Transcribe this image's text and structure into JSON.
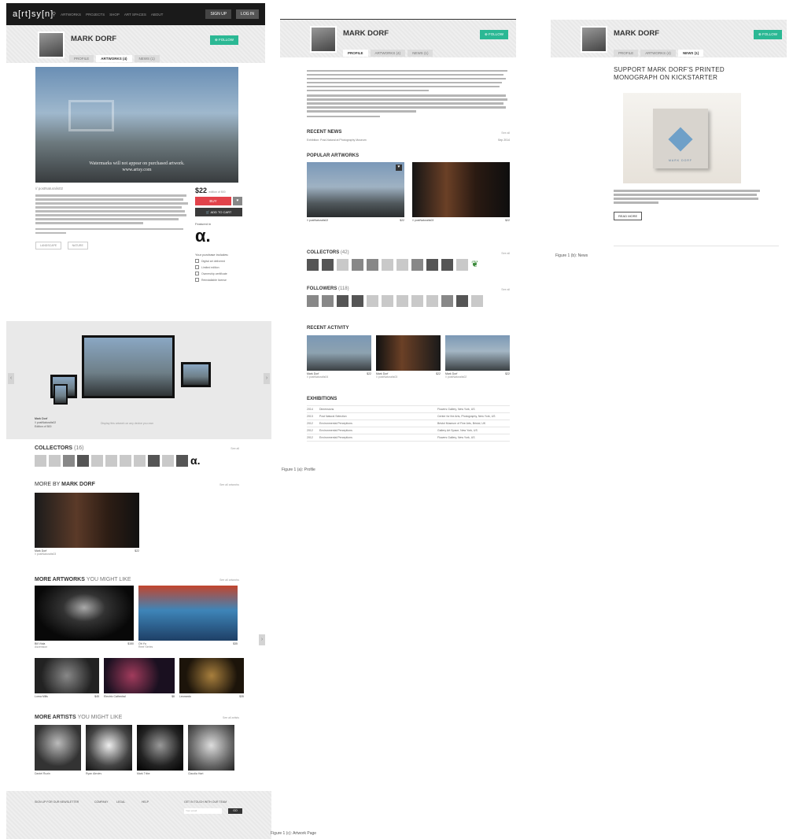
{
  "nav": {
    "logo": "a[rt]sy[n]",
    "links": [
      "ARTWORKS",
      "PROJECTS",
      "SHOP",
      "ART SPACES",
      "ABOUT"
    ],
    "signup": "SIGN UP",
    "login": "LOG IN"
  },
  "artist": {
    "name": "MARK DORF",
    "follow_label": "FOLLOW",
    "tabs": [
      "PROFILE",
      "ARTWORKS (4)",
      "NEWS (1)"
    ]
  },
  "artwork": {
    "watermark_line1": "Watermarks will not appear on purchased artwork.",
    "watermark_line2": "www.artsy.com",
    "caption": "// postNaturalis02",
    "price": "$22",
    "price_note": "edition of 500",
    "buy_label": "BUY",
    "add_to_cart": "ADD TO CART",
    "presented_by": "Featured in",
    "purchase_includes": "Your purchase includes:",
    "features": [
      "Digital art delivered",
      "Limited edition",
      "Ownership certificate",
      "Reinstallable license"
    ],
    "tags": [
      "LANDSCAPE",
      "NATURE"
    ]
  },
  "devices_band": {
    "caption_name": "Mark Dorf",
    "caption_work": "// postNaturalis02",
    "caption_detail": "Edition of 500",
    "note": "Display this artwork on any device you own"
  },
  "collectors": {
    "title": "COLLECTORS",
    "count": "(16)",
    "see_all": "See all"
  },
  "more_by": {
    "title_prefix": "MORE BY",
    "title_name": "MARK DORF",
    "see_all": "See all artworks",
    "art_name": "Mark Dorf",
    "art_title": "// postNaturalis03",
    "art_price": "$22"
  },
  "more_artworks": {
    "title_prefix": "MORE ARTWORKS",
    "title_suffix": "YOU MIGHT LIKE",
    "see_all": "See all artworks",
    "items": [
      {
        "artist": "Bill Viola",
        "title": "Ascension",
        "price": "$150"
      },
      {
        "artist": "Oh Yu",
        "title": "Reef Series",
        "price": "$35"
      },
      {
        "artist": "Lorna Mills",
        "title": "Gif Ghost",
        "price": "$45"
      },
      {
        "artist": "Electric Cathedral",
        "title": "Bliss 02",
        "price": "$8"
      },
      {
        "artist": "Leonardo",
        "title": "Garden",
        "price": "$35"
      }
    ]
  },
  "more_artists": {
    "title_prefix": "MORE ARTISTS",
    "title_suffix": "YOU MIGHT LIKE",
    "see_all": "See all artists",
    "items": [
      "Daniel Rozin",
      "Ryan Alexiev",
      "Mark Tribe",
      "Claudia Hart"
    ]
  },
  "footer": {
    "columns": [
      "SIGN UP FOR OUR NEWSLETTER",
      "COMPANY",
      "LEGAL",
      "HELP",
      "GET IN TOUCH WITH OUR TEAM"
    ],
    "newsletter_placeholder": "Your email",
    "newsletter_button": "GO"
  },
  "profile": {
    "recent_news": "RECENT NEWS",
    "recent_news_item": "Exhibition: Post-Natural at Photography Museum",
    "recent_news_date": "Sep 2014",
    "popular_artworks": "POPULAR ARTWORKS",
    "pop1_title": "// postNaturalis02",
    "pop1_price": "$22",
    "pop2_title": "// postNaturalis03",
    "pop2_price": "$22",
    "collectors": "COLLECTORS",
    "collectors_count": "(42)",
    "followers": "FOLLOWERS",
    "followers_count": "(118)",
    "recent_activity": "RECENT ACTIVITY",
    "activity": [
      {
        "name": "Mark Dorf",
        "title": "// postNaturalis04",
        "price": "$22"
      },
      {
        "name": "Mark Dorf",
        "title": "// postNaturalis03",
        "price": "$22"
      },
      {
        "name": "Mark Dorf",
        "title": "// postNaturalis02",
        "price": "$22"
      }
    ],
    "exhibitions": "EXHIBITIONS",
    "exhibition_rows": [
      {
        "year": "2014",
        "title": "Dimensions",
        "venue": "Flowers Gallery, New York, US"
      },
      {
        "year": "2013",
        "title": "Post Natural Selection",
        "venue": "Center for the Arts, Photography, New York, US"
      },
      {
        "year": "2012",
        "title": "Environmental Perceptions",
        "venue": "Bristol Museum of Fine Arts, Bristol, UK"
      },
      {
        "year": "2012",
        "title": "Environmental Perceptions",
        "venue": "Gallery Art Space, New York, US"
      },
      {
        "year": "2012",
        "title": "Environmental Perceptions",
        "venue": "Flowers Gallery, New York, US"
      }
    ],
    "see_all": "See all"
  },
  "news": {
    "title_line1": "SUPPORT MARK DORF'S PRINTED",
    "title_line2": "MONOGRAPH ON KICKSTARTER",
    "cover_text": "MARK DORF",
    "read_more": "READ MORE"
  },
  "captions": {
    "col1": "Figure 1 (c): Artwork Page",
    "col2": "Figure 1 (a): Profile",
    "col3": "Figure 1 (b): News"
  }
}
